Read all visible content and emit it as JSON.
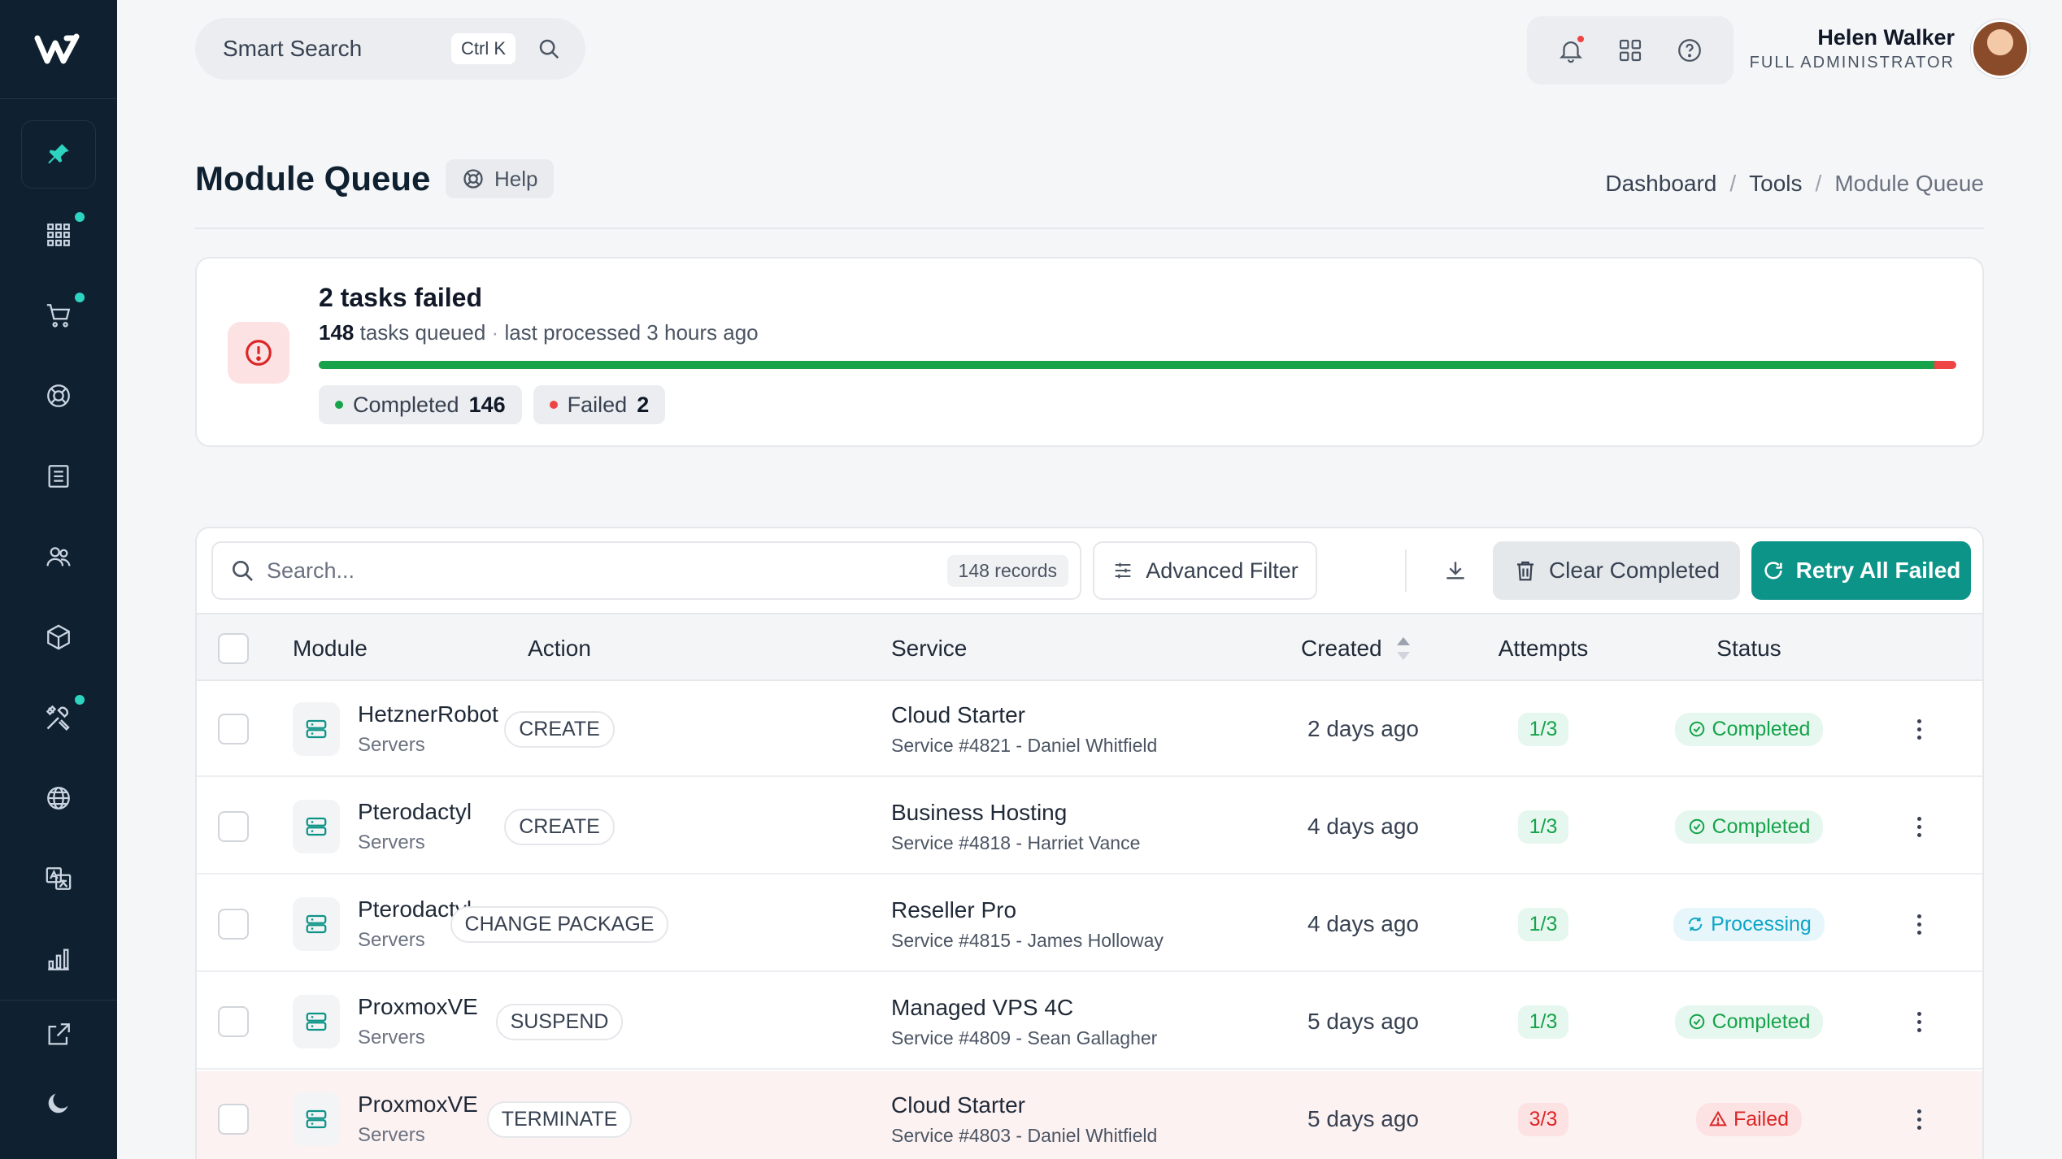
{
  "topbar": {
    "search_label": "Smart Search",
    "search_shortcut": "Ctrl K",
    "user": {
      "name": "Helen Walker",
      "role": "FULL ADMINISTRATOR"
    }
  },
  "header": {
    "title": "Module Queue",
    "help_label": "Help",
    "breadcrumb": [
      "Dashboard",
      "Tools",
      "Module Queue"
    ]
  },
  "summary": {
    "title": "2 tasks failed",
    "queued_count": "148",
    "queued_label": "tasks queued",
    "separator": "·",
    "last_processed": "last processed 3 hours ago",
    "progress_completed_fraction": 0.9865,
    "completed_label": "Completed",
    "completed_count": "146",
    "failed_label": "Failed",
    "failed_count": "2",
    "colors": {
      "completed": "#16a34a",
      "failed": "#ef4444"
    }
  },
  "toolbar": {
    "search_placeholder": "Search...",
    "records": "148 records",
    "advanced_filter": "Advanced Filter",
    "clear_completed": "Clear Completed",
    "retry_all_failed": "Retry All Failed",
    "accent": "#0d9488"
  },
  "table": {
    "columns": [
      "Module",
      "Action",
      "Service",
      "Created",
      "Attempts",
      "Status"
    ],
    "rows": [
      {
        "module": "HetznerRobot",
        "category": "Servers",
        "action": "CREATE",
        "service": "Cloud Starter",
        "service_detail": "Service #4821 - Daniel Whitfield",
        "created": "2 days ago",
        "attempts": "1/3",
        "status": "Completed"
      },
      {
        "module": "Pterodactyl",
        "category": "Servers",
        "action": "CREATE",
        "service": "Business Hosting",
        "service_detail": "Service #4818 - Harriet Vance",
        "created": "4 days ago",
        "attempts": "1/3",
        "status": "Completed"
      },
      {
        "module": "Pterodactyl",
        "category": "Servers",
        "action": "CHANGE PACKAGE",
        "service": "Reseller Pro",
        "service_detail": "Service #4815 - James Holloway",
        "created": "4 days ago",
        "attempts": "1/3",
        "status": "Processing"
      },
      {
        "module": "ProxmoxVE",
        "category": "Servers",
        "action": "SUSPEND",
        "service": "Managed VPS 4C",
        "service_detail": "Service #4809 - Sean Gallagher",
        "created": "5 days ago",
        "attempts": "1/3",
        "status": "Completed"
      },
      {
        "module": "ProxmoxVE",
        "category": "Servers",
        "action": "TERMINATE",
        "service": "Cloud Starter",
        "service_detail": "Service #4803 - Daniel Whitfield",
        "created": "5 days ago",
        "attempts": "3/3",
        "status": "Failed"
      }
    ]
  },
  "sidebar": {
    "items": [
      "pin-icon",
      "apps-grid-icon",
      "cart-icon",
      "support-icon",
      "invoice-icon",
      "users-icon",
      "box-icon",
      "tools-icon",
      "globe-icon",
      "translate-icon",
      "chart-icon"
    ],
    "bottom": [
      "external-link-icon",
      "moon-icon"
    ]
  }
}
